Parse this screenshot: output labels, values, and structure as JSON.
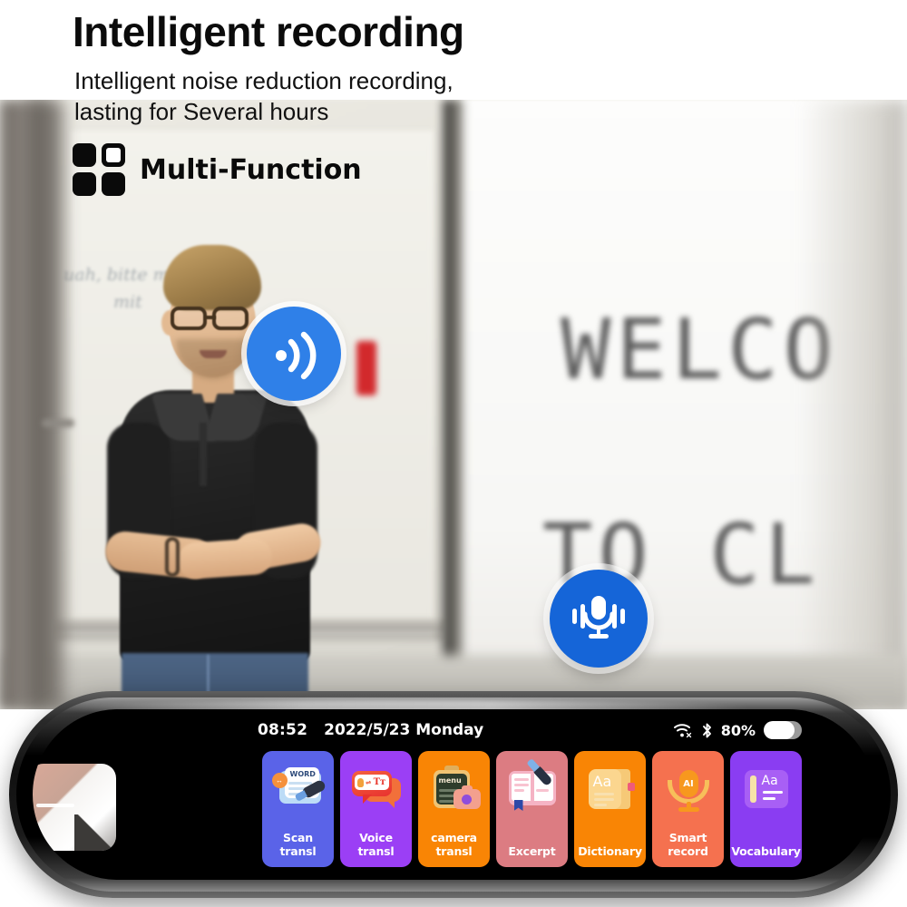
{
  "header": {
    "title": "Intelligent recording",
    "subtitle_line1": "Intelligent noise reduction recording,",
    "subtitle_line2": "lasting for Several hours",
    "feature_label": "Multi-Function",
    "grid_icon": "grid-four-squares-icon"
  },
  "photo": {
    "whiteboard_text_line1": "uah, bitte morgen",
    "whiteboard_text_line2": "mit",
    "projector_line1": "WELCO",
    "projector_line2": "TO CL"
  },
  "badges": [
    {
      "name": "signal-wave-icon",
      "label": "Wireless signal",
      "color": "#2f80e8"
    },
    {
      "name": "microphone-icon",
      "label": "Voice recording",
      "color": "#1565d8"
    }
  ],
  "device": {
    "statusbar": {
      "time": "08:52",
      "date": "2022/5/23 Monday",
      "wifi_icon": "wifi-disconnected-icon",
      "bluetooth_icon": "bluetooth-icon",
      "battery_percent": "80%",
      "battery_level": 80
    },
    "screen_protector_tab": "screen-protector-tab",
    "tiles": [
      {
        "label": "Scan transl",
        "bg": "#5a63e8",
        "icon": "scan-translate-icon",
        "art_word": "WORD",
        "art_badge": "↔"
      },
      {
        "label": "Voice transl",
        "bg": "#9b3ff5",
        "icon": "voice-translate-icon",
        "art_eq": "⇌",
        "art_tt": "Tᴛ"
      },
      {
        "label": "camera transl",
        "bg": "#f98505",
        "icon": "camera-translate-icon",
        "art_word": "menu"
      },
      {
        "label": "Excerpt",
        "bg": "#dc7c82",
        "icon": "excerpt-book-icon"
      },
      {
        "label": "Dictionary",
        "bg": "#f98505",
        "icon": "dictionary-book-icon",
        "art_word": "Aa"
      },
      {
        "label": "Smart record",
        "bg": "#f5714f",
        "icon": "ai-microphone-icon",
        "art_word": "AI"
      },
      {
        "label": "Vocabulary",
        "bg": "#8a3df2",
        "icon": "vocabulary-card-icon",
        "art_word": "Aa"
      }
    ]
  }
}
